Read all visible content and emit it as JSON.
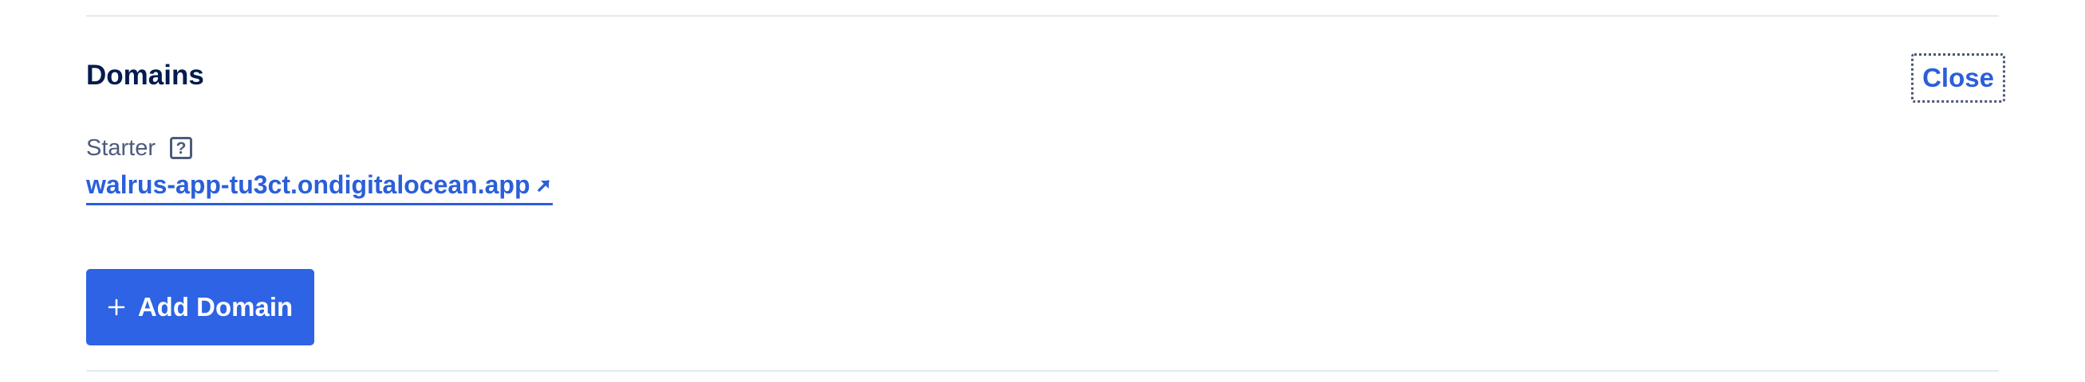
{
  "section": {
    "title": "Domains",
    "close_label": "Close"
  },
  "domain_entry": {
    "type_label": "Starter",
    "help_icon_glyph": "?",
    "link_text": "walrus-app-tu3ct.ondigitalocean.app",
    "link_icon": "external-link-arrow-icon"
  },
  "actions": {
    "add_domain_label": "Add Domain",
    "add_icon": "plus-icon"
  },
  "colors": {
    "link": "#2b5fd9",
    "primary_button": "#2d63e4",
    "heading": "#031b4e",
    "muted_text": "#4d5b7c",
    "divider": "#e5e8ed"
  }
}
